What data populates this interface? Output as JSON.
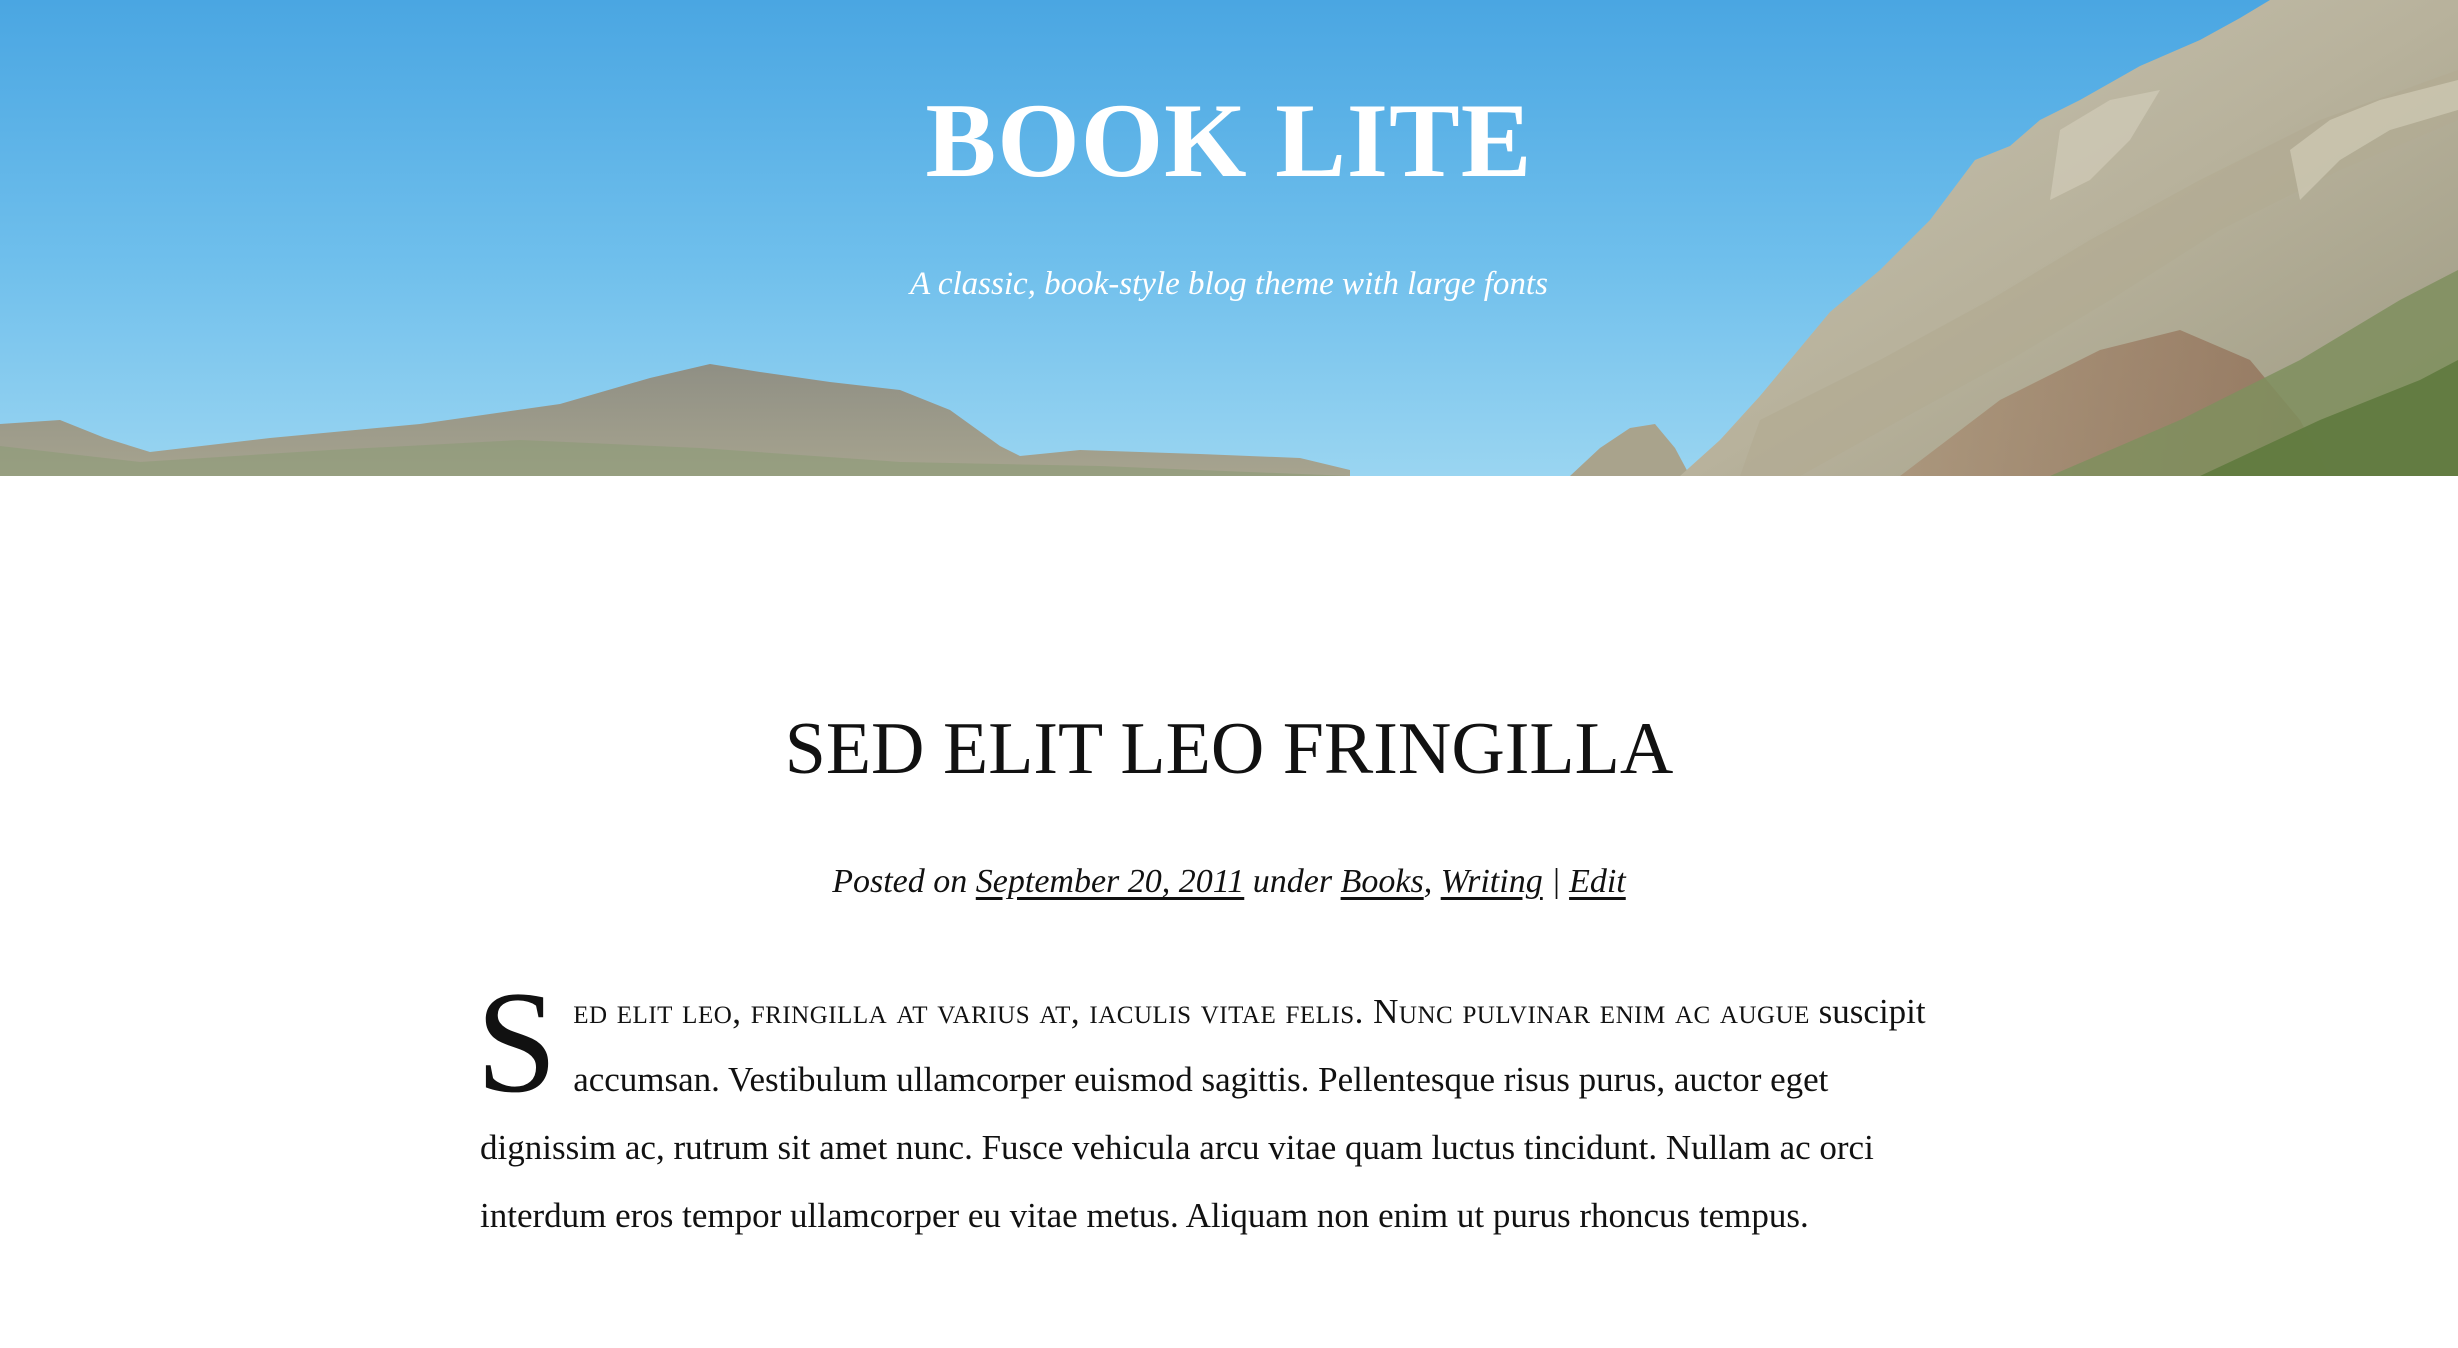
{
  "header": {
    "site_title": "BOOK LITE",
    "tagline": "A classic, book-style blog theme with large fonts",
    "colors": {
      "sky_top": "#4fa9e3",
      "sky_bottom": "#93d1f0",
      "text": "#ffffff"
    }
  },
  "post": {
    "title": "SED ELIT LEO FRINGILLA",
    "meta": {
      "prefix": "Posted on",
      "date": "September 20, 2011",
      "under": "under",
      "categories": [
        "Books",
        "Writing"
      ],
      "category_separator": ",",
      "edit_separator": "|",
      "edit_label": "Edit"
    },
    "content": {
      "drop_cap": "S",
      "lead_in": "ed elit leo, fringilla at varius at, iaculis vitae felis. Nunc pulvinar enim ac augue",
      "body": "suscipit accumsan. Vestibulum ullamcorper euismod sagittis. Pellentesque risus purus, auctor eget dignissim ac, rutrum sit amet nunc. Fusce vehicula arcu vitae quam luctus tincidunt. Nullam ac orci interdum eros tempor ullamcorper eu vitae metus. Aliquam non enim ut purus rhoncus tempus."
    }
  }
}
